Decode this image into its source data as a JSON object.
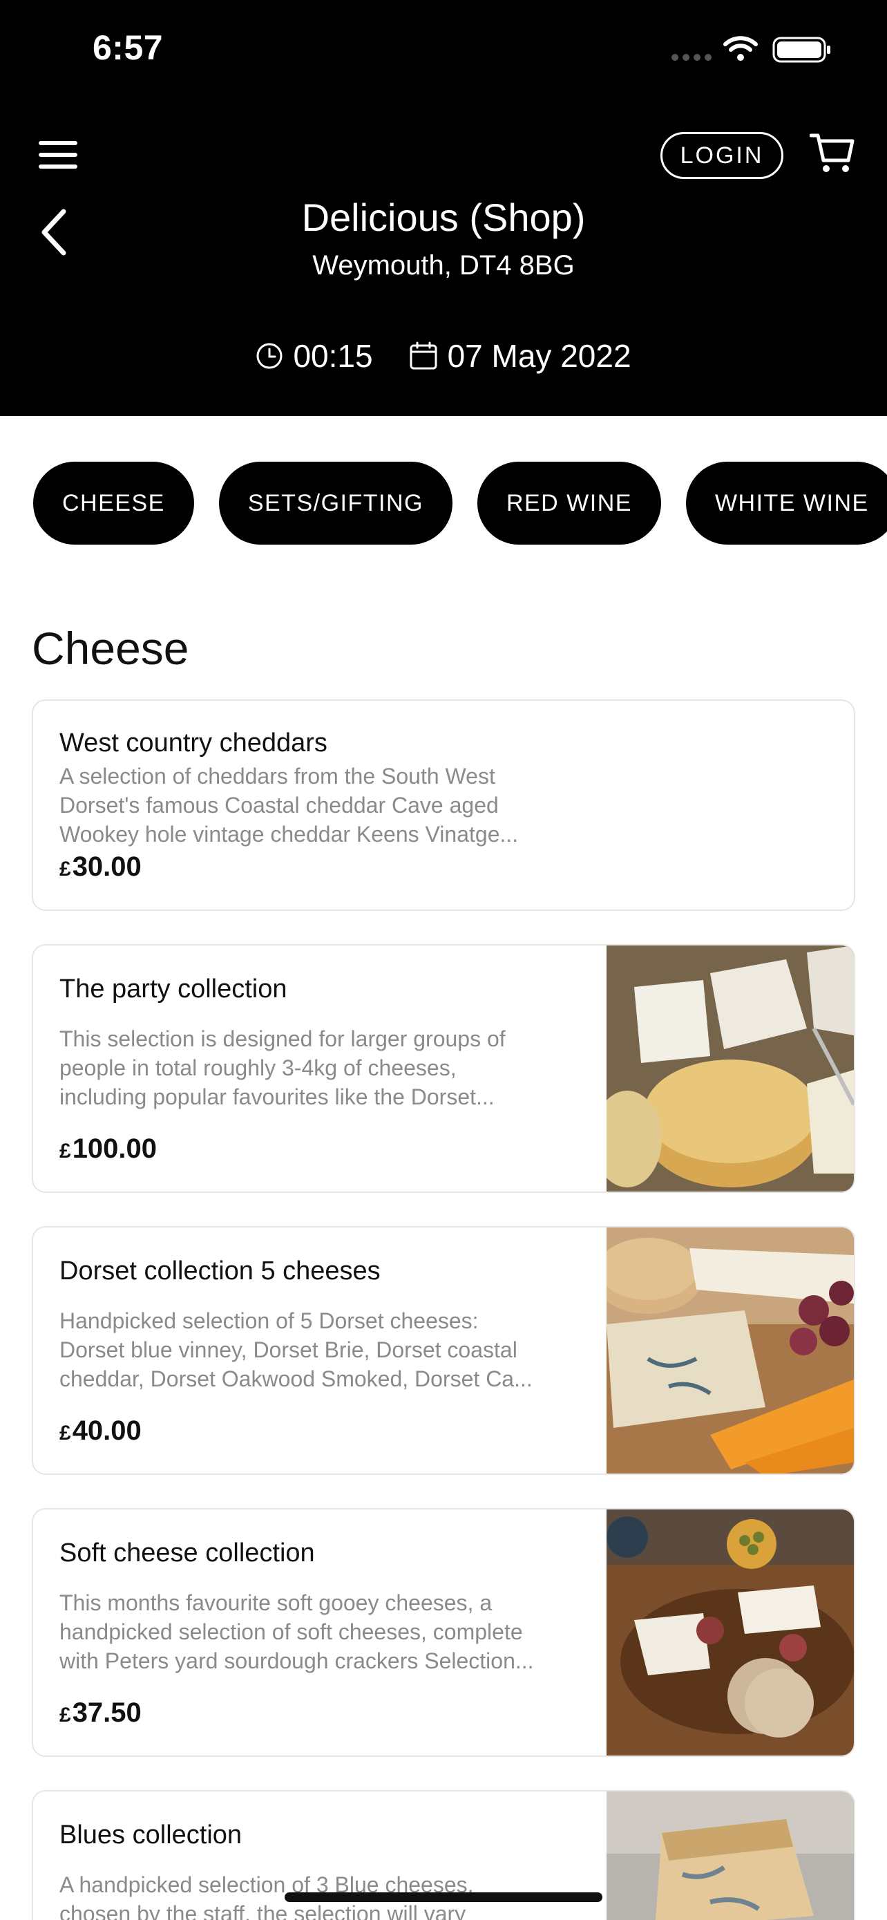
{
  "status_bar": {
    "time": "6:57"
  },
  "header": {
    "login_label": "LOGIN",
    "shop_title": "Delicious (Shop)",
    "location": "Weymouth, DT4 8BG",
    "time": "00:15",
    "date": "07 May 2022"
  },
  "icons": {
    "menu": "hamburger-menu-icon",
    "cart": "shopping-cart-icon",
    "back": "chevron-left-icon",
    "clock": "clock-icon",
    "calendar": "calendar-icon"
  },
  "category_tabs": [
    "CHEESE",
    "SETS/GIFTING",
    "RED WINE",
    "WHITE WINE"
  ],
  "section": {
    "title": "Cheese"
  },
  "products": [
    {
      "name": "West country cheddars",
      "description": [
        "A selection of cheddars from the South West",
        "Dorset's famous Coastal cheddar Cave aged",
        "Wookey hole vintage cheddar Keens Vinatge..."
      ],
      "currency": "£",
      "price": "30.00"
    },
    {
      "name": "The party collection",
      "description": [
        "This selection is designed for larger groups of",
        "people in total roughly 3-4kg of cheeses,",
        "including popular favourites like the Dorset..."
      ],
      "currency": "£",
      "price": "100.00"
    },
    {
      "name": "Dorset collection 5 cheeses",
      "description": [
        "Handpicked selection of 5 Dorset cheeses:",
        "Dorset blue vinney, Dorset Brie, Dorset coastal",
        "cheddar, Dorset Oakwood Smoked, Dorset Ca..."
      ],
      "currency": "£",
      "price": "40.00"
    },
    {
      "name": "Soft cheese collection",
      "description": [
        "This months favourite soft gooey cheeses, a",
        "handpicked selection of soft cheeses, complete",
        "with Peters yard sourdough crackers Selection..."
      ],
      "currency": "£",
      "price": "37.50"
    },
    {
      "name": "Blues collection",
      "description": [
        "A handpicked selection of 3 Blue cheeses,",
        "chosen by the staff, the selection will vary"
      ]
    }
  ],
  "colors": {
    "header_bg": "#000000",
    "tab_bg": "#000000",
    "muted_text": "#8a8a8a"
  }
}
